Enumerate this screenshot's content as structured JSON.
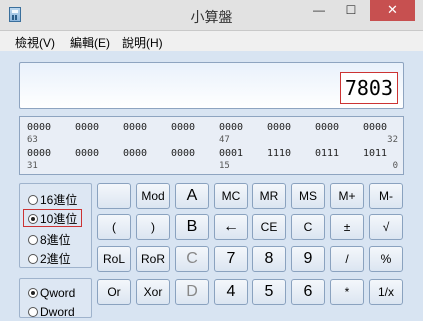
{
  "window": {
    "title": "小算盤",
    "controls": {
      "minimize": "—",
      "maximize": "☐",
      "close": "✕"
    }
  },
  "menu": [
    "檢視(V)",
    "編輯(E)",
    "說明(H)"
  ],
  "display": {
    "value": "7803"
  },
  "bits": {
    "row1": [
      "0000",
      "0000",
      "0000",
      "0000",
      "0000",
      "0000",
      "0000",
      "0000"
    ],
    "row1_pos": [
      "63",
      "47",
      "32"
    ],
    "row2": [
      "0000",
      "0000",
      "0000",
      "0000",
      "0001",
      "1110",
      "0111",
      "1011"
    ],
    "row2_pos": [
      "31",
      "15",
      "0"
    ]
  },
  "base_options": [
    {
      "label": "16進位",
      "selected": false
    },
    {
      "label": "10進位",
      "selected": true
    },
    {
      "label": "8進位",
      "selected": false
    },
    {
      "label": "2進位",
      "selected": false
    }
  ],
  "word_options": [
    {
      "label": "Qword",
      "selected": true
    },
    {
      "label": "Dword",
      "selected": false
    }
  ],
  "keys": {
    "row1": [
      "",
      "Mod",
      "A",
      "MC",
      "MR",
      "MS",
      "M+",
      "M-"
    ],
    "row2": [
      "(",
      ")",
      "B",
      "←",
      "CE",
      "C",
      "±",
      "√"
    ],
    "row3": [
      "RoL",
      "RoR",
      "C",
      "7",
      "8",
      "9",
      "/",
      "%"
    ],
    "row4": [
      "Or",
      "Xor",
      "D",
      "4",
      "5",
      "6",
      "*",
      "1/x"
    ]
  }
}
